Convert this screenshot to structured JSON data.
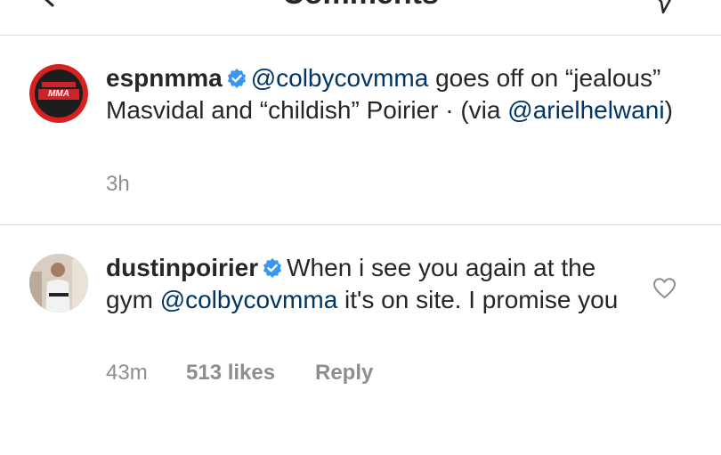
{
  "header": {
    "title": "Comments"
  },
  "caption": {
    "avatar_text": "MMA",
    "username": "espnmma",
    "mention1": "@colbycovmma",
    "text1": " goes off on “jealous” Masvidal and “childish” Poirier · (via ",
    "mention2": "@arielhelwani",
    "text2": ")",
    "time": "3h"
  },
  "comment": {
    "username": "dustinpoirier",
    "text1": "When i see you again at the gym ",
    "mention": "@colbycovmma",
    "text2": " it's on site. I promise you",
    "time": "43m",
    "likes": "513 likes",
    "reply": "Reply"
  },
  "icons": {
    "back": "chevron-left-icon",
    "send": "paper-plane-icon",
    "verified": "verified-badge-icon",
    "heart": "heart-outline-icon"
  },
  "colors": {
    "mention": "#003569",
    "verified": "#3897f0",
    "meta": "#8e8e8e",
    "divider": "#dbdbdb"
  }
}
